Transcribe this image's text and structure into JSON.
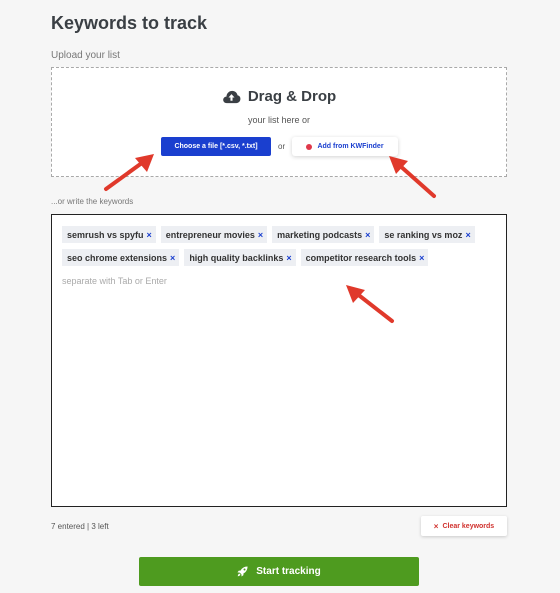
{
  "header": {
    "title": "Keywords to track"
  },
  "upload": {
    "label": "Upload your list",
    "dropzone_title": "Drag & Drop",
    "dropzone_sub": "your list here or",
    "choose_file_label": "Choose a file [*.csv, *.txt]",
    "or_text": "or",
    "kwfinder_label": "Add from KWFinder"
  },
  "keywords": {
    "label": "...or write the keywords",
    "tags": [
      "semrush vs spyfu",
      "entrepreneur movies",
      "marketing podcasts",
      "se ranking vs moz",
      "seo chrome extensions",
      "high quality backlinks",
      "competitor research tools"
    ],
    "remove_glyph": "×",
    "input_placeholder": "separate with Tab or Enter",
    "count_text": "7 entered | 3 left",
    "clear_label": "Clear keywords",
    "clear_glyph": "×"
  },
  "footer": {
    "start_label": "Start tracking"
  },
  "icons": {
    "cloud": "cloud-upload-icon",
    "kwfinder": "kwfinder-dot-icon",
    "rocket": "rocket-icon",
    "clear": "close-icon"
  },
  "colors": {
    "primary_blue": "#1a3fcf",
    "start_green": "#4e9b1f",
    "clear_red": "#d0312d",
    "annotation_red": "#e0392b",
    "kwfinder_dot": "#e0384a"
  }
}
